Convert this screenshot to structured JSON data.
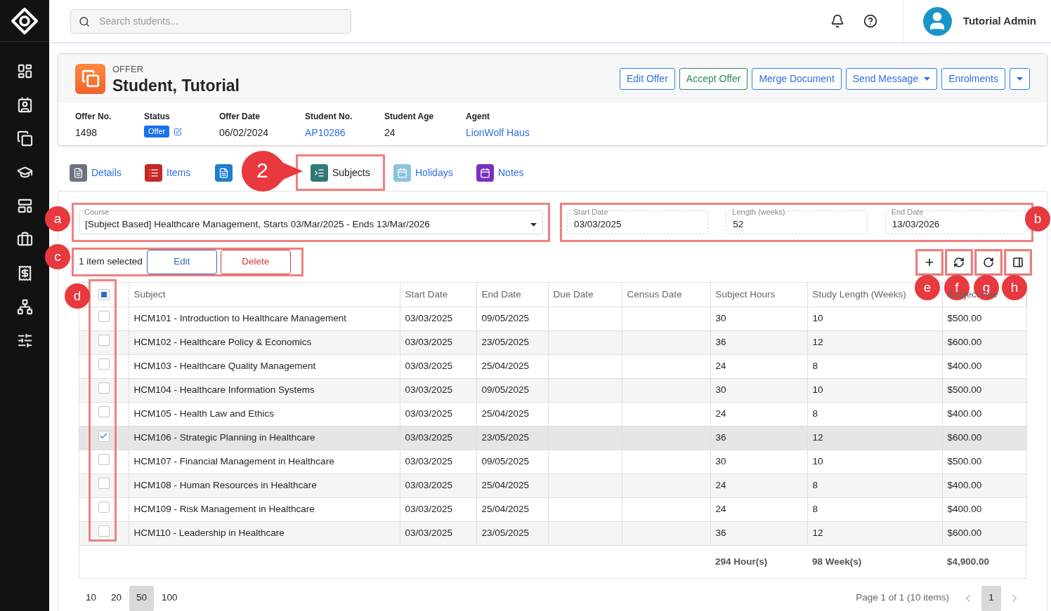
{
  "search": {
    "placeholder": "Search students..."
  },
  "user": {
    "name": "Tutorial Admin"
  },
  "offer": {
    "label": "OFFER",
    "name": "Student, Tutorial",
    "actions": [
      {
        "label": "Edit Offer",
        "kind": "primary"
      },
      {
        "label": "Accept Offer",
        "kind": "success"
      },
      {
        "label": "Merge Document",
        "kind": "primary"
      },
      {
        "label": "Send Message",
        "kind": "dropdown"
      },
      {
        "label": "Enrolments",
        "kind": "primary"
      },
      {
        "kind": "caret"
      }
    ],
    "fields": [
      {
        "label": "Offer No.",
        "value": "1498",
        "kind": "text"
      },
      {
        "label": "Status",
        "value": "Offer",
        "kind": "badge"
      },
      {
        "label": "Offer Date",
        "value": "06/02/2024",
        "kind": "text"
      },
      {
        "label": "Student No.",
        "value": "AP10286",
        "kind": "link"
      },
      {
        "label": "Student Age",
        "value": "24",
        "kind": "text"
      },
      {
        "label": "Agent",
        "value": "LionWolf Haus",
        "kind": "link"
      }
    ]
  },
  "tabs": [
    {
      "label": "Details",
      "selected": false,
      "color": "#6b7280"
    },
    {
      "label": "Items",
      "selected": false,
      "color": "#c62828"
    },
    {
      "selected": false,
      "color": "#1e7fd0"
    },
    {
      "label": "Subjects",
      "selected": true,
      "color": "#2f7a78"
    },
    {
      "label": "Holidays",
      "selected": false,
      "color": "#8cc4de"
    },
    {
      "label": "Notes",
      "selected": false,
      "color": "#7b2fbe"
    }
  ],
  "course": {
    "label": "Course",
    "value": "[Subject Based] Healthcare Management, Starts 03/Mar/2025 - Ends 13/Mar/2026"
  },
  "dates": [
    {
      "label": "Start Date",
      "value": "03/03/2025"
    },
    {
      "label": "Length (weeks)",
      "value": "52"
    },
    {
      "label": "End Date",
      "value": "13/03/2026"
    }
  ],
  "selection": {
    "text": "1 item selected",
    "edit": "Edit",
    "delete": "Delete"
  },
  "table": {
    "header_checkbox": {
      "indeterminate": true
    },
    "columns": [
      "Subject",
      "Start Date",
      "End Date",
      "Due Date",
      "Census Date",
      "Subject Hours",
      "Study Length (Weeks)",
      "Subject Fee"
    ],
    "rows": [
      {
        "selected": false,
        "cells": [
          "HCM101 - Introduction to Healthcare Management",
          "03/03/2025",
          "09/05/2025",
          "",
          "",
          "30",
          "10",
          "$500.00"
        ]
      },
      {
        "selected": false,
        "cells": [
          "HCM102 - Healthcare Policy & Economics",
          "03/03/2025",
          "23/05/2025",
          "",
          "",
          "36",
          "12",
          "$600.00"
        ]
      },
      {
        "selected": false,
        "cells": [
          "HCM103 - Healthcare Quality Management",
          "03/03/2025",
          "25/04/2025",
          "",
          "",
          "24",
          "8",
          "$400.00"
        ]
      },
      {
        "selected": false,
        "cells": [
          "HCM104 - Healthcare Information Systems",
          "03/03/2025",
          "09/05/2025",
          "",
          "",
          "30",
          "10",
          "$500.00"
        ]
      },
      {
        "selected": false,
        "cells": [
          "HCM105 - Health Law and Ethics",
          "03/03/2025",
          "25/04/2025",
          "",
          "",
          "24",
          "8",
          "$400.00"
        ]
      },
      {
        "selected": true,
        "cells": [
          "HCM106 - Strategic Planning in Healthcare",
          "03/03/2025",
          "23/05/2025",
          "",
          "",
          "36",
          "12",
          "$600.00"
        ]
      },
      {
        "selected": false,
        "cells": [
          "HCM107 - Financial Management in Healthcare",
          "03/03/2025",
          "09/05/2025",
          "",
          "",
          "30",
          "10",
          "$500.00"
        ]
      },
      {
        "selected": false,
        "cells": [
          "HCM108 - Human Resources in Healthcare",
          "03/03/2025",
          "25/04/2025",
          "",
          "",
          "24",
          "8",
          "$400.00"
        ]
      },
      {
        "selected": false,
        "cells": [
          "HCM109 - Risk Management in Healthcare",
          "03/03/2025",
          "25/04/2025",
          "",
          "",
          "24",
          "8",
          "$400.00"
        ]
      },
      {
        "selected": false,
        "cells": [
          "HCM110 - Leadership in Healthcare",
          "03/03/2025",
          "23/05/2025",
          "",
          "",
          "36",
          "12",
          "$600.00"
        ]
      }
    ],
    "totals": {
      "hours": "294 Hour(s)",
      "weeks": "98 Week(s)",
      "fee": "$4,900.00"
    }
  },
  "pagination": {
    "sizes": [
      {
        "label": "10",
        "selected": false
      },
      {
        "label": "20",
        "selected": false
      },
      {
        "label": "50",
        "selected": true
      },
      {
        "label": "100",
        "selected": false
      }
    ],
    "summary": "Page 1 of 1 (10 items)",
    "pages": [
      {
        "label": "1",
        "selected": true
      }
    ]
  },
  "annotations": {
    "step": "2",
    "markers": [
      "a",
      "b",
      "c",
      "d",
      "e",
      "f",
      "g",
      "h"
    ]
  }
}
